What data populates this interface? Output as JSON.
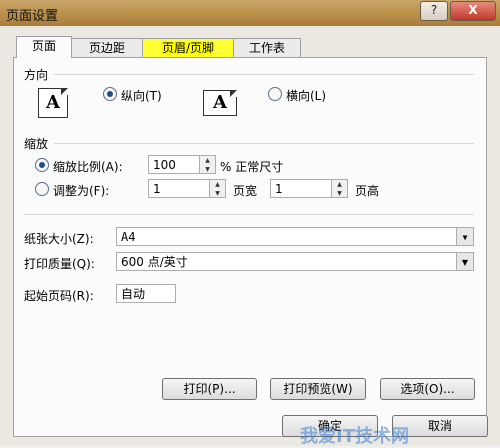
{
  "window": {
    "title": "页面设置",
    "help_label": "?",
    "close_label": "X"
  },
  "tabs": [
    {
      "label": "页面"
    },
    {
      "label": "页边距"
    },
    {
      "label": "页眉/页脚"
    },
    {
      "label": "工作表"
    }
  ],
  "orientation": {
    "heading": "方向",
    "portrait_label": "纵向(T)",
    "landscape_label": "横向(L)",
    "icon_glyph": "A",
    "selected": "portrait"
  },
  "scaling": {
    "heading": "缩放",
    "adjust_label": "缩放比例(A):",
    "adjust_value": "100",
    "adjust_unit": "% 正常尺寸",
    "fit_label": "调整为(F):",
    "fit_wide_value": "1",
    "fit_wide_unit": "页宽",
    "fit_tall_value": "1",
    "fit_tall_unit": "页高",
    "selected": "adjust"
  },
  "paper_size": {
    "label": "纸张大小(Z):",
    "value": "A4"
  },
  "print_quality": {
    "label": "打印质量(Q):",
    "value": "600 点/英寸"
  },
  "first_page": {
    "label": "起始页码(R):",
    "value": "自动"
  },
  "buttons": {
    "print": "打印(P)...",
    "preview": "打印预览(W)",
    "options": "选项(O)...",
    "ok": "确定",
    "cancel": "取消"
  },
  "watermark": "我爱IT技术网",
  "colors": {
    "tab_highlight": "#ffff00",
    "titlebar": "#b98f4a",
    "radio_dot": "#1f4f8f"
  }
}
